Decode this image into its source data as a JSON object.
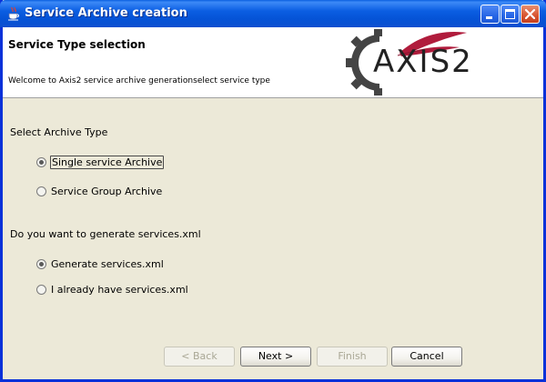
{
  "window": {
    "title": "Service Archive creation"
  },
  "header": {
    "title": "Service Type selection",
    "description": "Welcome to Axis2 service archive generationselect service type",
    "logo_text": "AXIS2"
  },
  "archive_type": {
    "label": "Select Archive Type",
    "options": [
      {
        "label": "Single service Archive",
        "selected": true
      },
      {
        "label": "Service Group Archive",
        "selected": false
      }
    ]
  },
  "services_xml": {
    "label": "Do you want to generate services.xml",
    "options": [
      {
        "label": "Generate services.xml",
        "selected": true
      },
      {
        "label": "I already have services.xml",
        "selected": false
      }
    ]
  },
  "buttons": {
    "back": {
      "label": "< Back",
      "enabled": false
    },
    "next": {
      "label": "Next >",
      "enabled": true
    },
    "finish": {
      "label": "Finish",
      "enabled": false
    },
    "cancel": {
      "label": "Cancel",
      "enabled": true
    }
  },
  "colors": {
    "titlebar": "#0b5ee2",
    "background": "#ece9d8",
    "close_button": "#d8542f"
  },
  "icons": {
    "title": "java-cup-icon",
    "logo": "axis2-gear-feather-logo"
  }
}
